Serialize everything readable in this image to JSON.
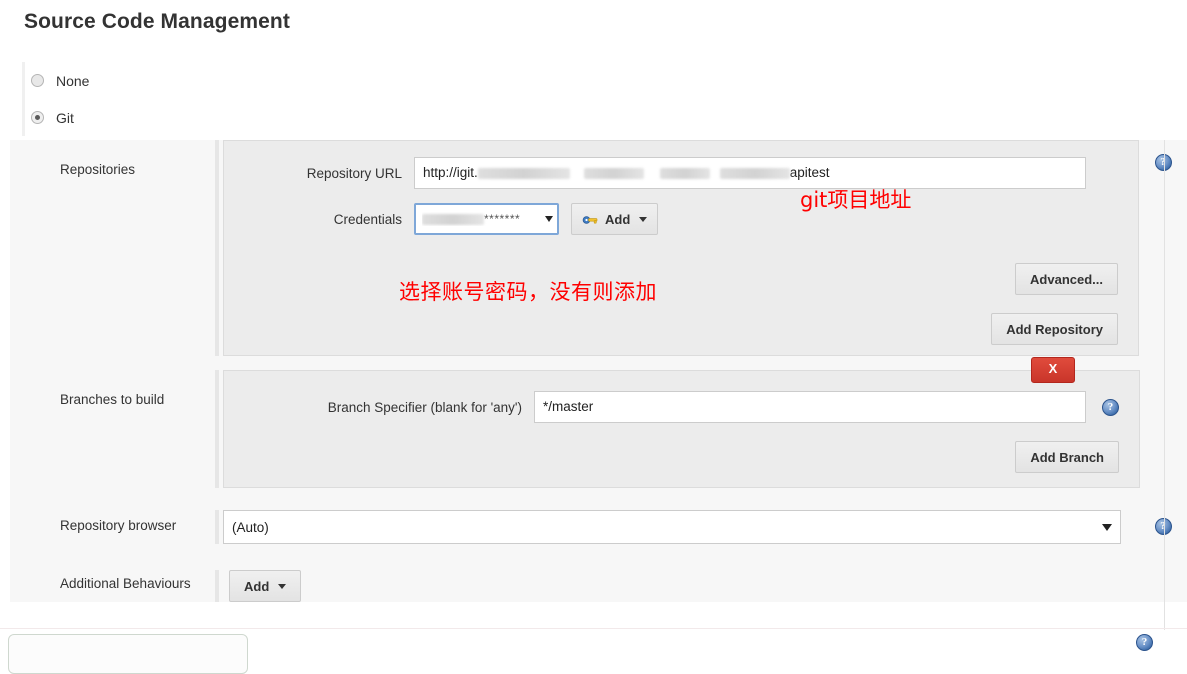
{
  "page": {
    "title": "Source Code Management"
  },
  "scm_options": [
    {
      "label": "None",
      "selected": false
    },
    {
      "label": "Git",
      "selected": true
    }
  ],
  "rows": {
    "repositories": {
      "label": "Repositories",
      "repository_url": {
        "label": "Repository URL",
        "value_prefix": "http://igit.",
        "value_suffix": "apitest",
        "annotation": "git项目地址"
      },
      "credentials": {
        "label": "Credentials",
        "value": "*******",
        "add_button": "Add",
        "annotation": "选择账号密码，没有则添加"
      },
      "advanced_button": "Advanced...",
      "add_repository_button": "Add Repository"
    },
    "branches": {
      "label": "Branches to build",
      "branch_specifier": {
        "label": "Branch Specifier (blank for 'any')",
        "value": "*/master"
      },
      "delete_button": "X",
      "add_branch_button": "Add Branch"
    },
    "repository_browser": {
      "label": "Repository browser",
      "value": "(Auto)"
    },
    "additional_behaviours": {
      "label": "Additional Behaviours",
      "add_button": "Add"
    }
  },
  "help": {
    "glyph": "?"
  },
  "colors": {
    "annotation_red": "#ff0000",
    "delete_red": "#c9352a",
    "help_blue": "#3d6dab",
    "focus_blue": "#7ea7d8",
    "panel_bg": "#ececec",
    "page_bg": "#f7f7f7"
  }
}
